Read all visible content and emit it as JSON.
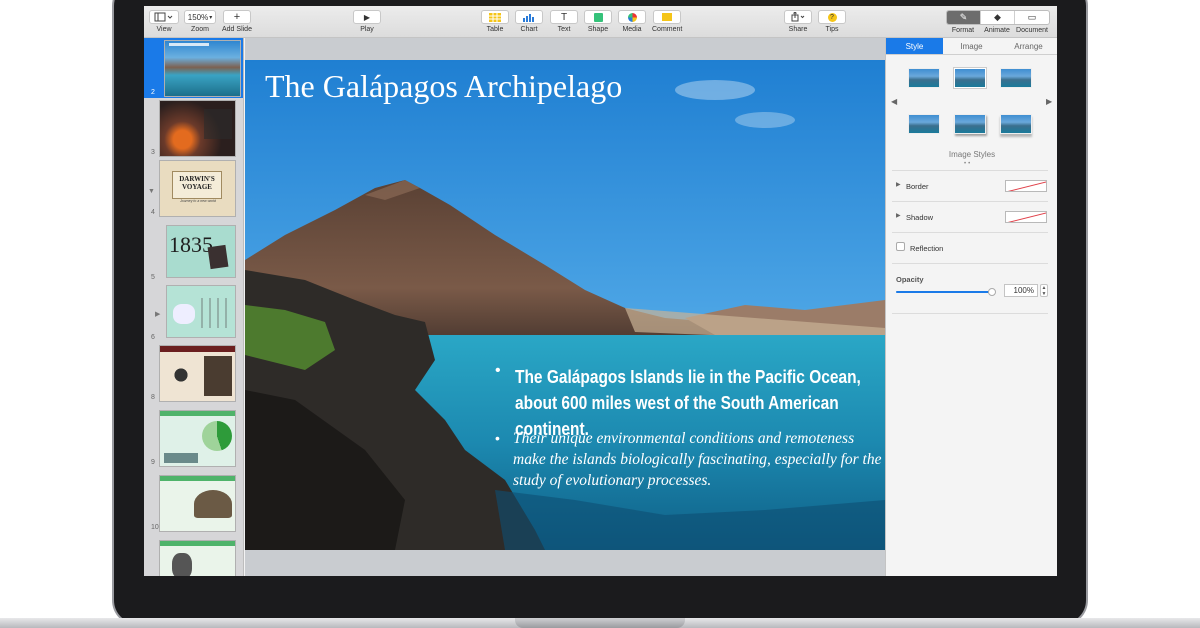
{
  "toolbar": {
    "view_label": "View",
    "zoom_value": "150%",
    "zoom_label": "Zoom",
    "add_slide_label": "Add Slide",
    "play_label": "Play",
    "table_label": "Table",
    "chart_label": "Chart",
    "text_label": "Text",
    "text_icon": "T",
    "shape_label": "Shape",
    "media_label": "Media",
    "comment_label": "Comment",
    "share_label": "Share",
    "tips_label": "Tips",
    "tips_icon": "?",
    "format_label": "Format",
    "animate_label": "Animate",
    "document_label": "Document",
    "accent_color": "#f5c518"
  },
  "navigator": {
    "slides": [
      {
        "number": "2",
        "selected": true
      },
      {
        "number": "3"
      },
      {
        "number": "4",
        "collapsed_icon": "▼",
        "thumb_title": "DARWIN'S VOYAGE",
        "thumb_subtitle": "Journey to a new world"
      },
      {
        "number": "5",
        "thumb_big": "1835"
      },
      {
        "number": "6",
        "expand_icon": "▶"
      },
      {
        "number": "8"
      },
      {
        "number": "9"
      },
      {
        "number": "10"
      }
    ]
  },
  "slide": {
    "title": "The Galápagos Archipelago",
    "bullet_1": "The Galápagos Islands lie in the Pacific Ocean, about 600 miles west of the South American continent.",
    "bullet_2": "Their unique environmental conditions and remoteness make the islands biologically fascinating, especially for the study of evolutionary processes.",
    "bullet_glyph": "•"
  },
  "inspector": {
    "tabs": [
      "Style",
      "Image",
      "Arrange"
    ],
    "active_tab": "Style",
    "image_styles_label": "Image Styles",
    "border_label": "Border",
    "shadow_label": "Shadow",
    "reflection_label": "Reflection",
    "opacity_label": "Opacity",
    "opacity_value": "100%",
    "opacity_fraction": 1.0,
    "accent_color": "#1a7ae8"
  }
}
